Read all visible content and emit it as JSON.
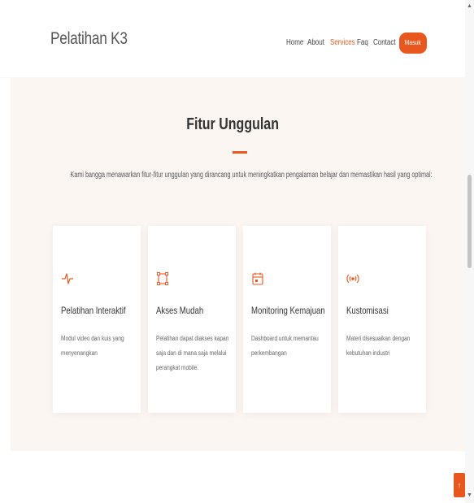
{
  "header": {
    "brand": "Pelatihan K3",
    "nav": [
      {
        "label": "Home",
        "active": false
      },
      {
        "label": "About",
        "active": false
      },
      {
        "label": "Services",
        "active": true
      },
      {
        "label": "Faq",
        "active": false
      },
      {
        "label": "Contact",
        "active": false
      }
    ],
    "login_button": "Masuk"
  },
  "section": {
    "title": "Fitur Unggulan",
    "subtitle": "Kami bangga menawarkan fitur-fitur unggulan yang dirancang untuk meningkatkan pengalaman belajar dan memastikan hasil yang optimal:",
    "cards": [
      {
        "icon": "activity-pulse-icon",
        "title": "Pelatihan Interaktif",
        "description": "Modul video dan kuis yang menyenangkan"
      },
      {
        "icon": "bounding-box-icon",
        "title": "Akses Mudah",
        "description": "Pelatihan dapat diakses kapan saja dan di mana saja melalui perangkat mobile."
      },
      {
        "icon": "calendar-icon",
        "title": "Monitoring Kemajuan",
        "description": "Dashboard untuk memantau perkembangan"
      },
      {
        "icon": "broadcast-icon",
        "title": "Kustomisasi",
        "description": "Materi disesuaikan dengan kebutuhan industri"
      }
    ]
  },
  "back_to_top": {
    "icon": "arrow-up-icon"
  },
  "colors": {
    "accent": "#e8571e",
    "section_bg": "#fcf6f3"
  }
}
